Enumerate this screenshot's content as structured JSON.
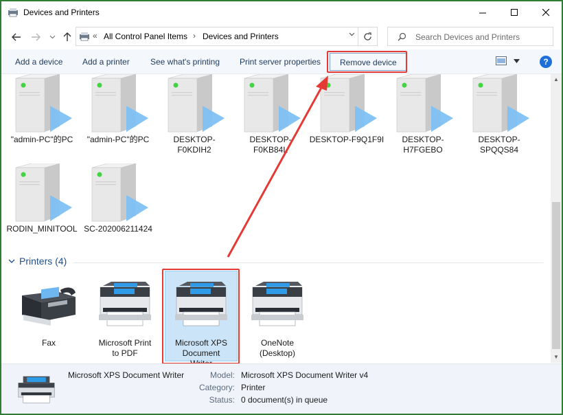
{
  "window": {
    "title": "Devices and Printers"
  },
  "address": {
    "chevrons": "«",
    "crumb1": "All Control Panel Items",
    "separator": "›",
    "crumb2": "Devices and Printers"
  },
  "search": {
    "placeholder": "Search Devices and Printers"
  },
  "commands": {
    "add_device": "Add a device",
    "add_printer": "Add a printer",
    "see_printing": "See what's printing",
    "print_server": "Print server properties",
    "remove_device": "Remove device",
    "help": "?"
  },
  "devices": [
    {
      "label": "\"admin-PC\"的PC"
    },
    {
      "label": "\"admin-PC\"的PC"
    },
    {
      "label": "DESKTOP-F0KDIH2"
    },
    {
      "label": "DESKTOP-F0KB84L"
    },
    {
      "label": "DESKTOP-F9Q1F9I"
    },
    {
      "label": "DESKTOP-H7FGEBO"
    },
    {
      "label": "DESKTOP-SPQQS84"
    },
    {
      "label": "RODIN_MINITOOL"
    },
    {
      "label": "SC-202006211424"
    }
  ],
  "printers_group": {
    "title": "Printers (4)"
  },
  "printers": [
    {
      "label": "Fax",
      "icon": "fax-icon"
    },
    {
      "label": "Microsoft Print to PDF",
      "icon": "printer-icon"
    },
    {
      "label": "Microsoft XPS Document Writer",
      "icon": "printer-icon",
      "selected": true
    },
    {
      "label": "OneNote (Desktop)",
      "icon": "printer-icon"
    }
  ],
  "details": {
    "name": "Microsoft XPS Document Writer",
    "model_label": "Model:",
    "model": "Microsoft XPS Document Writer v4",
    "category_label": "Category:",
    "category": "Printer",
    "status_label": "Status:",
    "status": "0 document(s) in queue"
  },
  "colors": {
    "highlight": "#e53935",
    "accent": "#1e6fd9",
    "selection": "#cce4f7",
    "window_border": "#2e7d32"
  }
}
